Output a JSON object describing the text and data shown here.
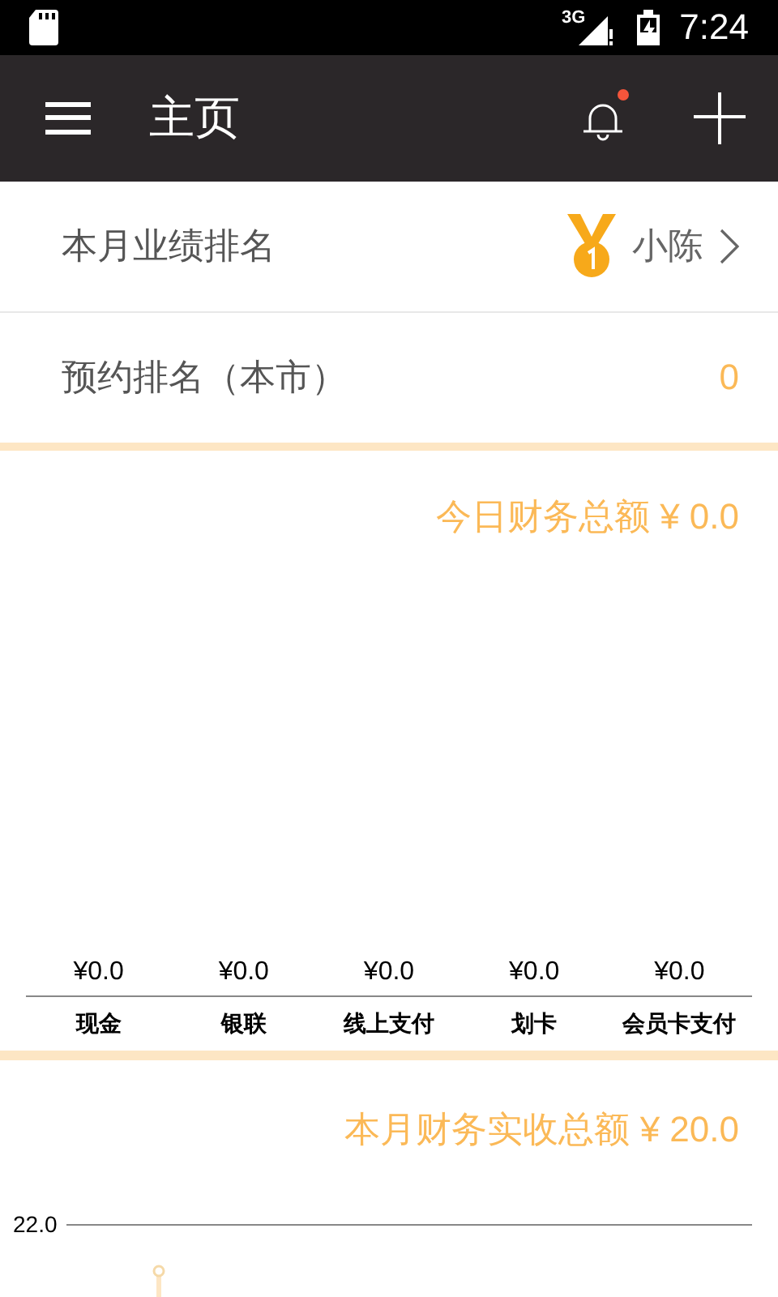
{
  "status_bar": {
    "network": "3G",
    "time": "7:24"
  },
  "app_bar": {
    "title": "主页",
    "notification_unread": true
  },
  "ranking_rows": [
    {
      "kind": "medal",
      "label": "本月业绩排名",
      "value": "小陈"
    },
    {
      "kind": "count",
      "label": "预约排名（本市）",
      "value": "0"
    }
  ],
  "today_finance": {
    "title": "今日财务总额 ¥ 0.0",
    "items": [
      {
        "amount": "¥0.0",
        "label": "现金"
      },
      {
        "amount": "¥0.0",
        "label": "银联"
      },
      {
        "amount": "¥0.0",
        "label": "线上支付"
      },
      {
        "amount": "¥0.0",
        "label": "划卡"
      },
      {
        "amount": "¥0.0",
        "label": "会员卡支付"
      }
    ]
  },
  "month_finance": {
    "title": "本月财务实收总额 ¥ 20.0",
    "axis_label": "22.0"
  }
}
